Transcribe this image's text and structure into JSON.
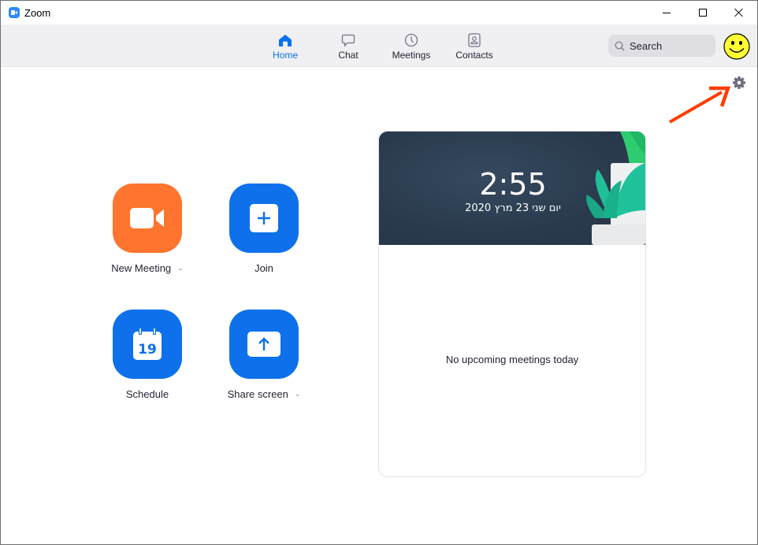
{
  "window": {
    "title": "Zoom",
    "controls": {
      "minimize": "minimize",
      "maximize": "maximize",
      "close": "close"
    }
  },
  "nav": {
    "tabs": [
      {
        "id": "home",
        "label": "Home",
        "icon": "home-icon",
        "active": true
      },
      {
        "id": "chat",
        "label": "Chat",
        "icon": "chat-bubble-icon",
        "active": false
      },
      {
        "id": "meetings",
        "label": "Meetings",
        "icon": "clock-icon",
        "active": false
      },
      {
        "id": "contacts",
        "label": "Contacts",
        "icon": "contact-card-icon",
        "active": false
      }
    ],
    "search": {
      "placeholder": "Search",
      "value": ""
    },
    "avatar": {
      "icon": "smiley-face-avatar"
    }
  },
  "settings": {
    "icon": "gear-icon",
    "annotation": "red-arrow-pointing-to-settings"
  },
  "actions": [
    {
      "id": "new-meeting",
      "label": "New Meeting",
      "icon": "video-camera-icon",
      "has_dropdown": true,
      "color": "#ff742e"
    },
    {
      "id": "join",
      "label": "Join",
      "icon": "plus-icon",
      "has_dropdown": false,
      "color": "#0e71eb"
    },
    {
      "id": "schedule",
      "label": "Schedule",
      "icon": "calendar-icon",
      "calendar_day": "19",
      "has_dropdown": false,
      "color": "#0e71eb"
    },
    {
      "id": "share-screen",
      "label": "Share screen",
      "icon": "upload-arrow-icon",
      "has_dropdown": true,
      "color": "#0e71eb"
    }
  ],
  "card": {
    "time": "2:55",
    "date": "יום שני 23 מרץ 2020",
    "empty_message": "No upcoming meetings today"
  },
  "colors": {
    "accent_blue": "#0e71eb",
    "accent_orange": "#ff742e",
    "annotation_red": "#ff3d00",
    "header_dark": "#2c3e52"
  }
}
